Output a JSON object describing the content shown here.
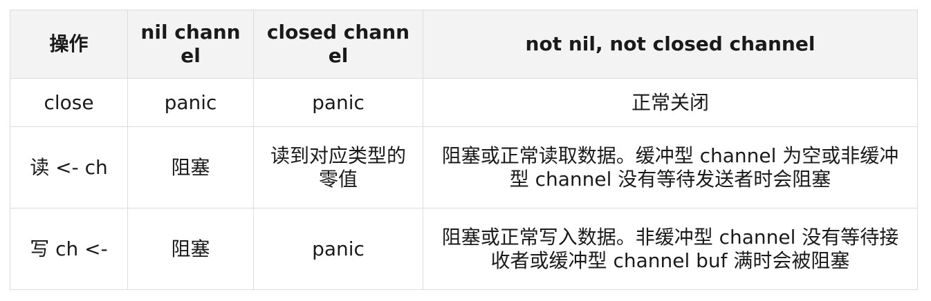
{
  "table": {
    "headers": [
      "操作",
      "nil channel",
      "closed channel",
      "not nil, not closed channel"
    ],
    "rows": [
      [
        "close",
        "panic",
        "panic",
        "正常关闭"
      ],
      [
        "读 <- ch",
        "阻塞",
        "读到对应类型的零值",
        "阻塞或正常读取数据。缓冲型 channel 为空或非缓冲型 channel 没有等待发送者时会阻塞"
      ],
      [
        "写 ch <-",
        "阻塞",
        "panic",
        "阻塞或正常写入数据。非缓冲型 channel 没有等待接收者或缓冲型 channel buf 满时会被阻塞"
      ]
    ]
  }
}
